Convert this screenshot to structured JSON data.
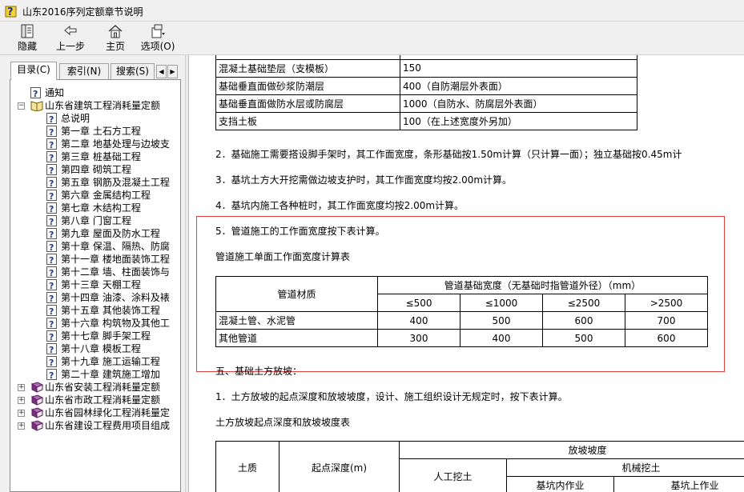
{
  "window": {
    "title": "山东2016序列定额章节说明"
  },
  "toolbar": {
    "buttons": [
      {
        "label": "隐藏",
        "icon": "hide-icon"
      },
      {
        "label": "上一步",
        "icon": "back-arrow-icon"
      },
      {
        "label": "主页",
        "icon": "home-icon"
      },
      {
        "label": "选项(O)",
        "icon": "options-icon"
      }
    ]
  },
  "tabs": [
    {
      "label": "目录(C)",
      "active": true
    },
    {
      "label": "索引(N)",
      "active": false
    },
    {
      "label": "搜索(S)",
      "active": false
    }
  ],
  "tree": {
    "notice": "通知",
    "building": "山东省建筑工程消耗量定额",
    "chapters": [
      "总说明",
      "第一章 土石方工程",
      "第二章 地基处理与边坡支",
      "第三章 桩基础工程",
      "第四章 砌筑工程",
      "第五章 钢筋及混凝土工程",
      "第六章 金属结构工程",
      "第七章 木结构工程",
      "第八章 门窗工程",
      "第九章 屋面及防水工程",
      "第十章 保温、隔热、防腐",
      "第十一章 楼地面装饰工程",
      "第十二章 墙、柱面装饰与",
      "第十三章 天棚工程",
      "第十四章 油漆、涂料及裱",
      "第十五章 其他装饰工程",
      "第十六章 构筑物及其他工",
      "第十七章 脚手架工程",
      "第十八章 模板工程",
      "第十九章 施工运输工程",
      "第二十章 建筑施工增加"
    ],
    "other_books": [
      "山东省安装工程消耗量定额",
      "山东省市政工程消耗量定额",
      "山东省园林绿化工程消耗量定",
      "山东省建设工程费用项目组成"
    ]
  },
  "content": {
    "top_table": [
      [
        "混凝土基础垫层（支模板）",
        "150"
      ],
      [
        "基础垂直面做砂浆防潮层",
        "400（自防潮层外表面）"
      ],
      [
        "基础垂直面做防水层或防腐层",
        "1000（自防水、防腐层外表面）"
      ],
      [
        "支挡土板",
        "100（在上述宽度外另加）"
      ]
    ],
    "para2": "2．基础施工需要搭设脚手架时，其工作面宽度，条形基础按1.50m计算（只计算一面）；独立基础按0.45m计",
    "para3": "3．基坑土方大开挖需做边坡支护时，其工作面宽度均按2.00m计算。",
    "para4": "4．基坑内施工各种桩时，其工作面宽度均按2.00m计算。",
    "para5": "5．管道施工的工作面宽度按下表计算。",
    "pipe_table_title": "管道施工单面工作面宽度计算表",
    "pipe_table": {
      "material_header": "管道材质",
      "width_header": "管道基础宽度（无基础时指管道外径）（mm）",
      "cols": [
        "≤500",
        "≤1000",
        "≤2500",
        ">2500"
      ],
      "rows": [
        {
          "name": "混凝土管、水泥管",
          "values": [
            "400",
            "500",
            "600",
            "700"
          ]
        },
        {
          "name": "其他管道",
          "values": [
            "300",
            "400",
            "500",
            "600"
          ]
        }
      ]
    },
    "section5": "五、基础土方放坡：",
    "para_slope1": "1．土方放坡的起点深度和放坡坡度，设计、施工组织设计无规定时，按下表计算。",
    "slope_table_title": "土方放坡起点深度和放坡坡度表",
    "slope_table": {
      "soil": "土质",
      "start_depth": "起点深度(m)",
      "slope": "放坡坡度",
      "manual": "人工挖土",
      "machine": "机械挖土",
      "in_pit": "基坑内作业",
      "on_pit": "基坑上作业"
    }
  }
}
